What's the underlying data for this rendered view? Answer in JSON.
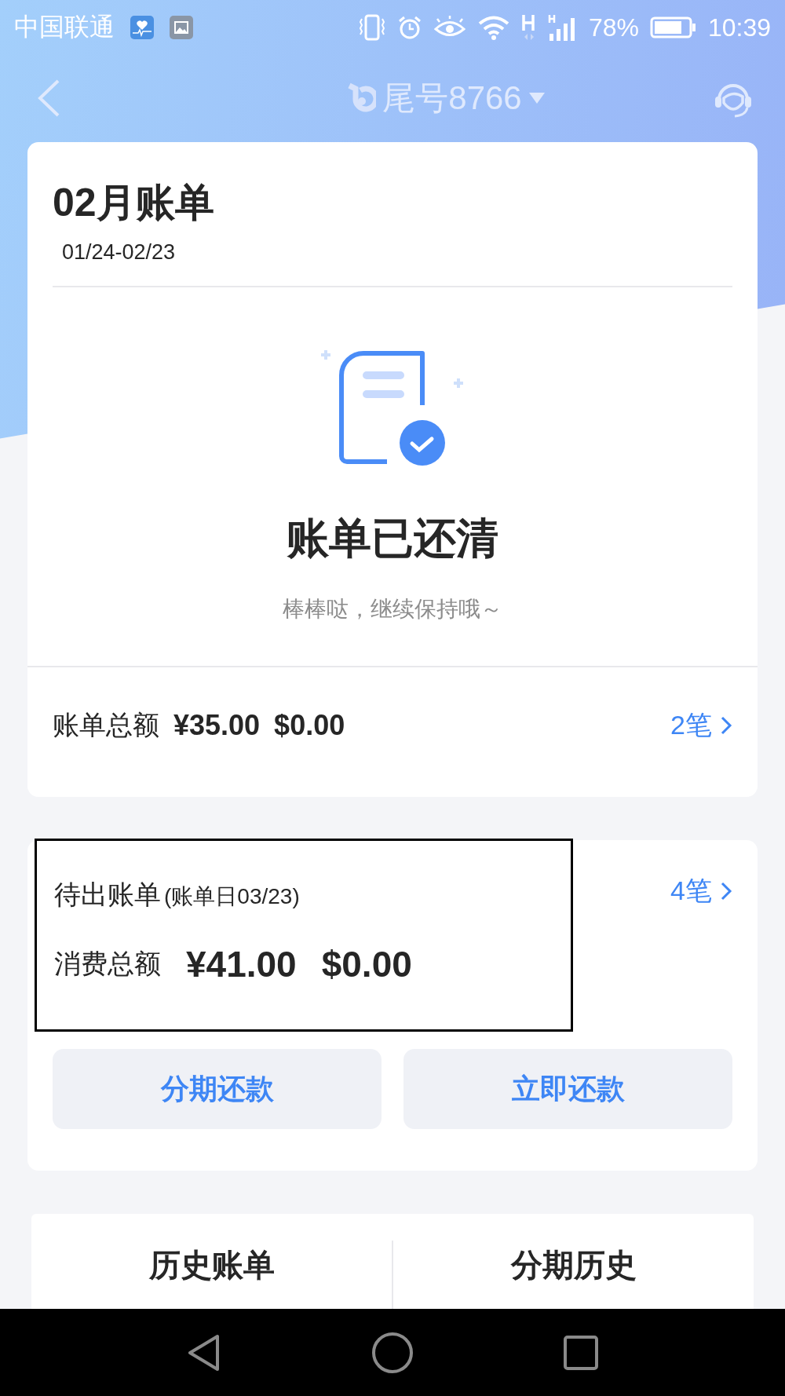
{
  "status_bar": {
    "carrier": "中国联通",
    "battery": "78%",
    "time": "10:39"
  },
  "header": {
    "title": "尾号8766"
  },
  "bill": {
    "title": "02月账单",
    "period": "01/24-02/23",
    "status": "账单已还清",
    "message": "棒棒哒，继续保持哦～",
    "total_label": "账单总额",
    "amount_cny": "¥35.00",
    "amount_usd": "$0.00",
    "count": "2笔"
  },
  "pending": {
    "title": "待出账单",
    "note": "(账单日03/23)",
    "count": "4笔",
    "label": "消费总额",
    "amount_cny": "¥41.00",
    "amount_usd": "$0.00",
    "highlighted": true
  },
  "buttons": [
    "分期还款",
    "立即还款"
  ],
  "history": [
    {
      "title": "历史账单"
    },
    {
      "title": "分期历史"
    }
  ]
}
